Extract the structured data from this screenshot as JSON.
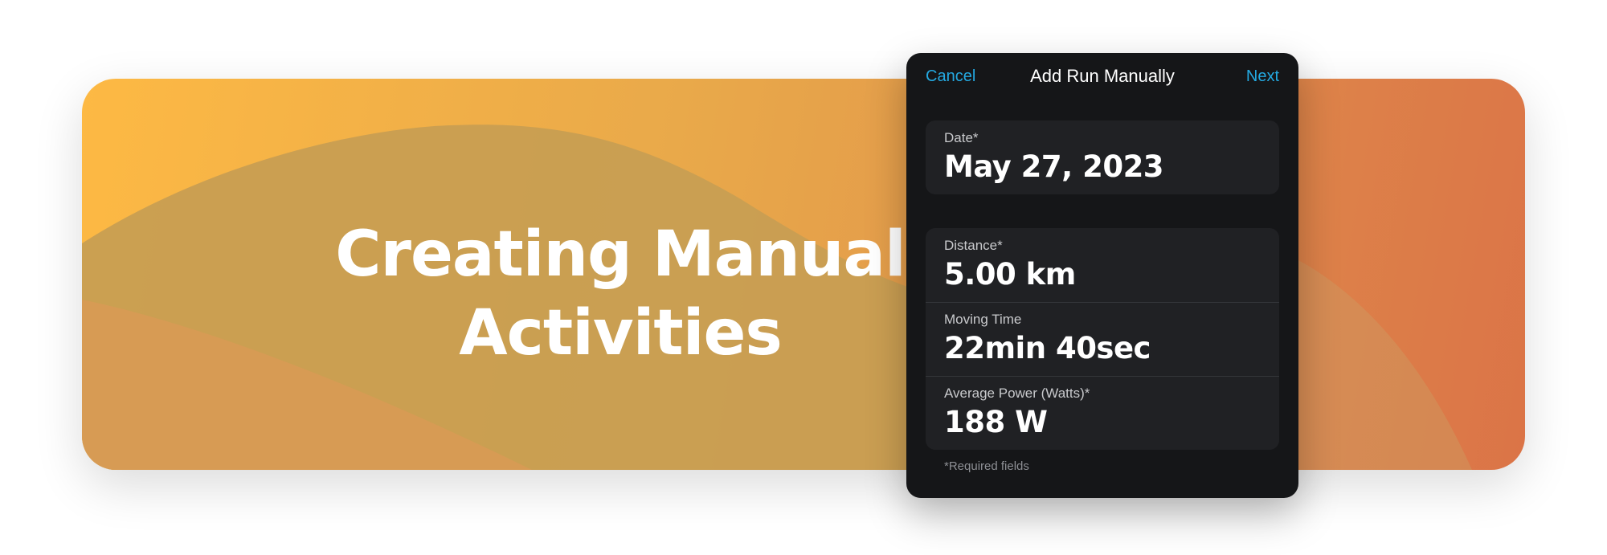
{
  "banner": {
    "headline_line1": "Creating Manual",
    "headline_line2": "Activities"
  },
  "sheet": {
    "title": "Add Run Manually",
    "cancel_label": "Cancel",
    "next_label": "Next",
    "date_field": {
      "label": "Date*",
      "value": "May 27, 2023"
    },
    "metrics": [
      {
        "label": "Distance*",
        "value": "5.00 km"
      },
      {
        "label": "Moving Time",
        "value": "22min 40sec"
      },
      {
        "label": "Average Power (Watts)*",
        "value": "188 W"
      }
    ],
    "footnote": "*Required fields"
  },
  "colors": {
    "accent": "#24a9e1",
    "sheet_background": "#151618",
    "card_background": "#202124",
    "banner_start": "#fdb944",
    "banner_end": "#db7447"
  }
}
